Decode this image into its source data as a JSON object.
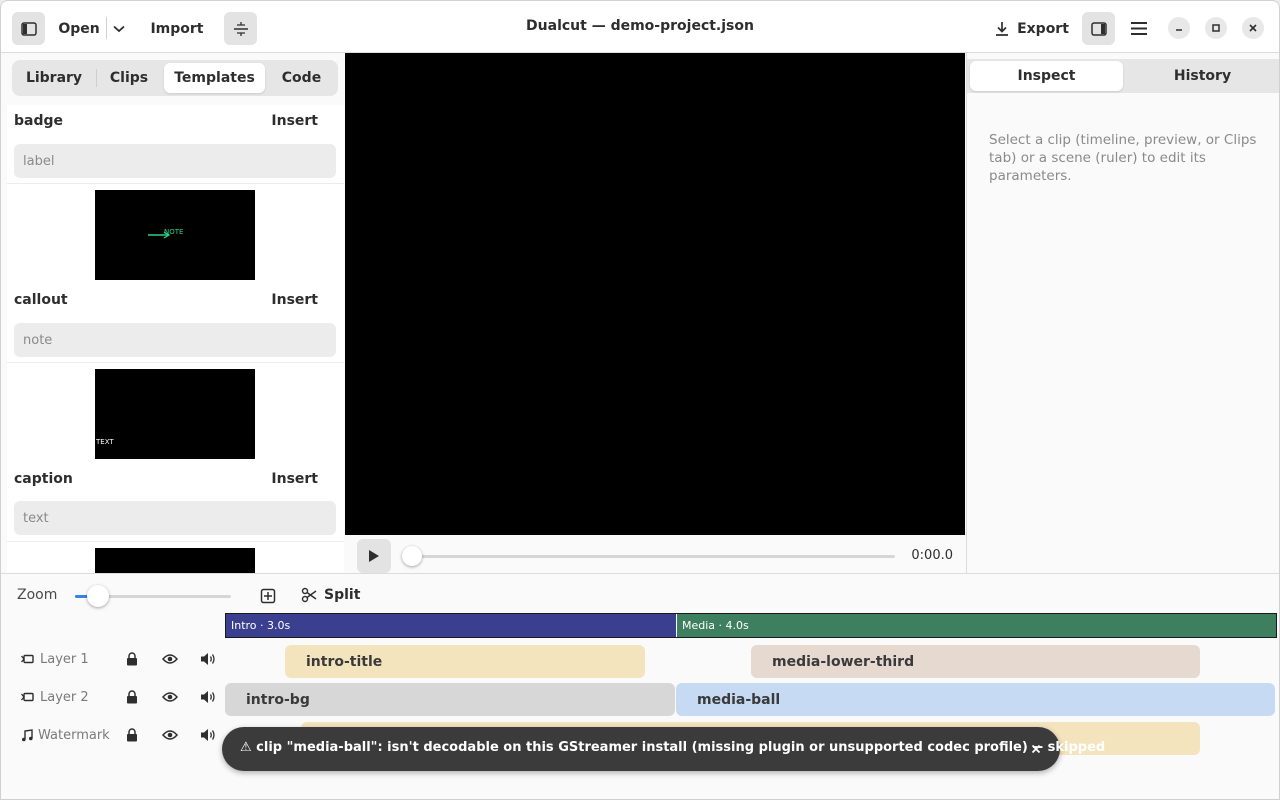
{
  "app": {
    "title": "Dualcut — demo-project.json"
  },
  "header": {
    "open_label": "Open",
    "import_label": "Import",
    "export_label": "Export",
    "icons": [
      "sidebar-toggle-icon",
      "chevron-down-icon",
      "split-layout-icon",
      "download-icon",
      "right-panel-icon",
      "hamburger-menu-icon",
      "minimize-icon",
      "maximize-icon",
      "close-icon"
    ]
  },
  "left_panel": {
    "tabs": [
      {
        "label": "Library"
      },
      {
        "label": "Clips"
      },
      {
        "label": "Templates",
        "active": true
      },
      {
        "label": "Code"
      }
    ],
    "templates": [
      {
        "name": "badge",
        "insert_label": "Insert",
        "placeholder": "label"
      },
      {
        "name": "callout",
        "insert_label": "Insert",
        "placeholder": "note",
        "thumb_text": "NOTE",
        "thumb_color": "#2fd08a"
      },
      {
        "name": "caption",
        "insert_label": "Insert",
        "placeholder": "text",
        "thumb_text": "TEXT"
      }
    ]
  },
  "preview": {
    "timecode": "0:00.0",
    "playhead_fraction": 0
  },
  "right_panel": {
    "tabs": [
      {
        "label": "Inspect",
        "active": true
      },
      {
        "label": "History"
      }
    ],
    "hint": "Select a clip (timeline, preview, or Clips tab) or a scene (ruler) to edit its parameters."
  },
  "timeline": {
    "zoom_label": "Zoom",
    "zoom_fraction": 0.15,
    "split_label": "Split",
    "scenes": [
      {
        "label": "Intro · 3.0s",
        "color": "#3a3f8f"
      },
      {
        "label": "Media · 4.0s",
        "color": "#3d7f5f"
      }
    ],
    "tracks": [
      {
        "label": "Layer 1",
        "kind": "video"
      },
      {
        "label": "Layer 2",
        "kind": "video"
      },
      {
        "label": "Watermark",
        "kind": "audio"
      }
    ],
    "clips": [
      {
        "name": "intro-title",
        "color": "#f3e4bd"
      },
      {
        "name": "media-lower-third",
        "color": "#e6d9d0"
      },
      {
        "name": "intro-bg",
        "color": "#d7d7d7"
      },
      {
        "name": "media-ball",
        "color": "#c6daf4"
      },
      {
        "name": "",
        "color": "#f3e4bd"
      }
    ]
  },
  "toast": {
    "icon": "warning-icon",
    "message": "⚠ clip \"media-ball\": isn't decodable on this GStreamer install (missing plugin or unsupported codec profile) -- skipped"
  }
}
